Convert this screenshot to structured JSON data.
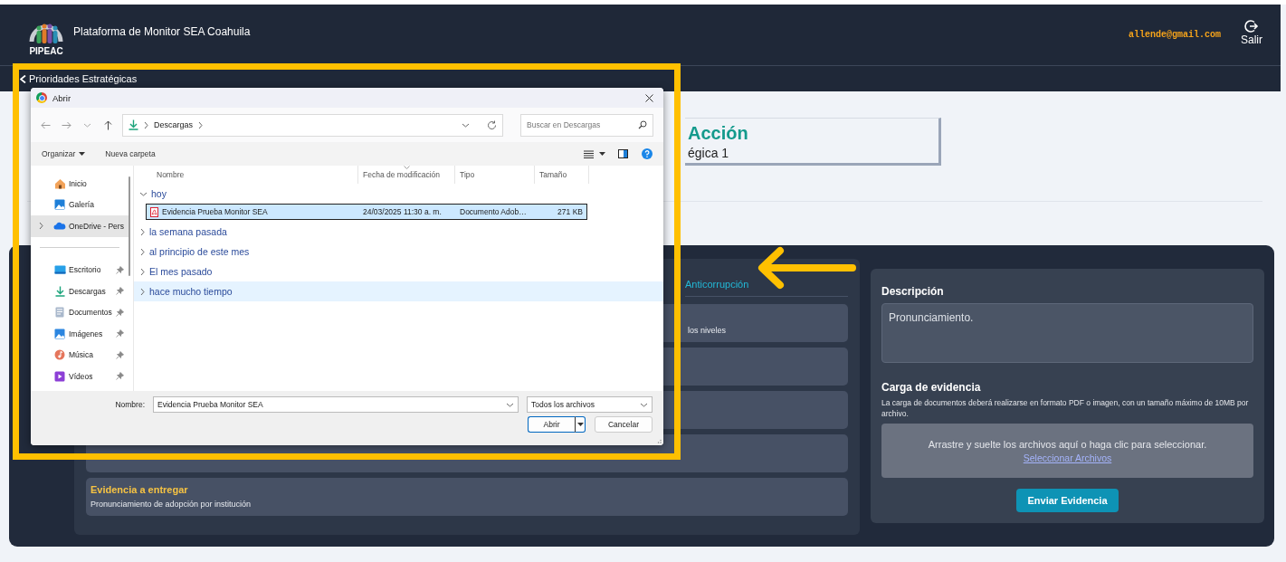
{
  "header": {
    "logo_text": "PIPEAC",
    "title": "Plataforma de Monitor SEA Coahuila",
    "user_email": "allende@gmail.com",
    "logout_label": "Salir"
  },
  "nav": {
    "back_label": "Prioridades Estratégicas"
  },
  "action_card": {
    "title": "Acción",
    "subtitle": "égica 1"
  },
  "left_panel": {
    "link": "Anticorrupción",
    "cards": [
      {
        "kind": "partial",
        "description": "los niveles"
      },
      {
        "kind": "hidden"
      },
      {
        "kind": "hidden"
      },
      {
        "kind": "hidden"
      },
      {
        "kind": "full",
        "title": "Evidencia a entregar",
        "description": "Pronunciamiento de adopción por institución"
      }
    ]
  },
  "right_panel": {
    "description_label": "Descripción",
    "description_value": "Pronunciamiento.",
    "upload_title": "Carga de evidencia",
    "upload_note": "La carga de documentos deberá realizarse en formato PDF o imagen, con un tamaño máximo de 10MB por archivo.",
    "dropzone_text": "Arrastre y suelte los archivos aquí o haga clic para seleccionar.",
    "dropzone_link": "Seleccionar Archivos",
    "submit_label": "Enviar Evidencia"
  },
  "dialog": {
    "title": "Abrir",
    "breadcrumb": [
      "Descargas"
    ],
    "search_placeholder": "Buscar en Descargas",
    "organize_label": "Organizar",
    "new_folder_label": "Nueva carpeta",
    "nav_sections": [
      {
        "items": [
          {
            "label": "Inicio",
            "selected": false,
            "pinned": false,
            "expandable": false
          },
          {
            "label": "Galería",
            "selected": false,
            "pinned": false,
            "expandable": false
          },
          {
            "label": "OneDrive - Pers",
            "selected": true,
            "pinned": false,
            "expandable": true
          }
        ]
      },
      {
        "items": [
          {
            "label": "Escritorio",
            "selected": false,
            "pinned": true,
            "expandable": false
          },
          {
            "label": "Descargas",
            "selected": false,
            "pinned": true,
            "expandable": false
          },
          {
            "label": "Documentos",
            "selected": false,
            "pinned": true,
            "expandable": false
          },
          {
            "label": "Imágenes",
            "selected": false,
            "pinned": true,
            "expandable": false
          },
          {
            "label": "Música",
            "selected": false,
            "pinned": true,
            "expandable": false
          },
          {
            "label": "Vídeos",
            "selected": false,
            "pinned": true,
            "expandable": false
          }
        ]
      }
    ],
    "columns": [
      "Nombre",
      "Fecha de modificación",
      "Tipo",
      "Tamaño"
    ],
    "groups": [
      {
        "label": "hoy",
        "expanded": true,
        "hovered": false,
        "files": [
          {
            "name": "Evidencia Prueba Monitor SEA",
            "date": "24/03/2025 11:30 a. m.",
            "type": "Documento Adob…",
            "size": "271 KB",
            "selected": true
          }
        ]
      },
      {
        "label": "la semana pasada",
        "expanded": false,
        "hovered": false
      },
      {
        "label": "al principio de este mes",
        "expanded": false,
        "hovered": false
      },
      {
        "label": "El mes pasado",
        "expanded": false,
        "hovered": false
      },
      {
        "label": "hace mucho tiempo",
        "expanded": false,
        "hovered": true
      }
    ],
    "filename_label": "Nombre:",
    "filename_value": "Evidencia Prueba Monitor SEA",
    "filter": "Todos los archivos",
    "open_label": "Abrir",
    "cancel_label": "Cancelar"
  }
}
